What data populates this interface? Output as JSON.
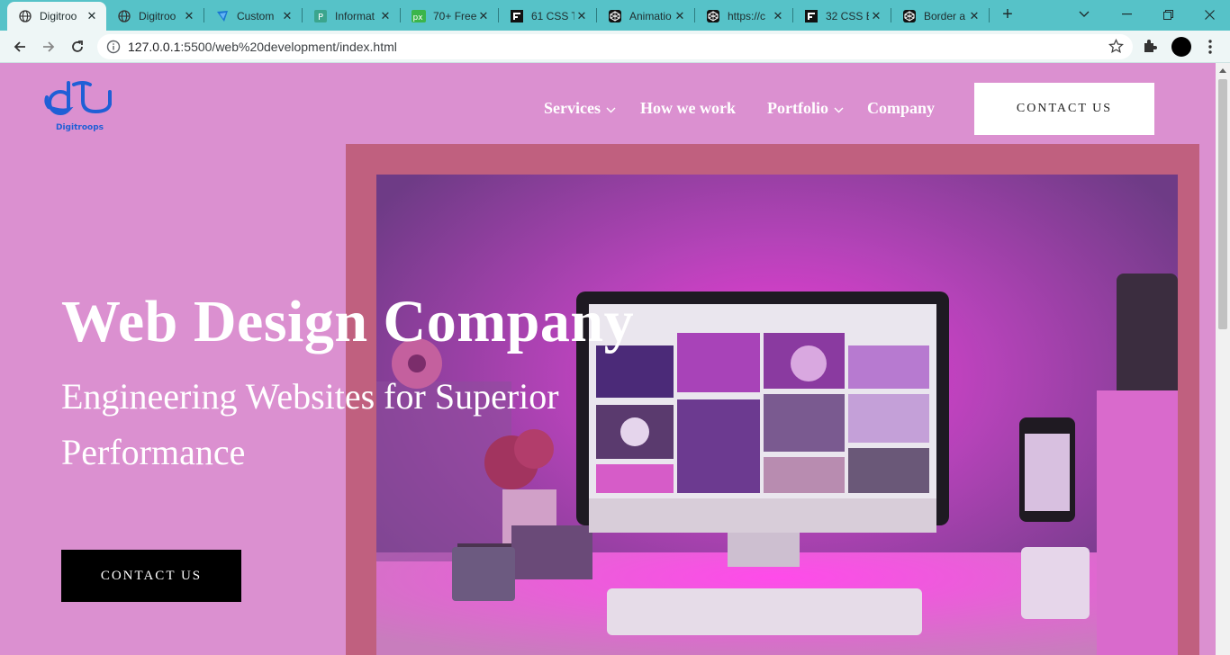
{
  "browser": {
    "tabs": [
      {
        "title": "Digitroo",
        "icon": "globe-icon",
        "active": true
      },
      {
        "title": "Digitroo",
        "icon": "globe-icon",
        "active": false
      },
      {
        "title": "Custom",
        "icon": "angular-icon",
        "active": false
      },
      {
        "title": "Informat",
        "icon": "p-icon",
        "active": false
      },
      {
        "title": "70+ Free",
        "icon": "px-icon",
        "active": false
      },
      {
        "title": "61 CSS T",
        "icon": "f-icon",
        "active": false
      },
      {
        "title": "Animatio",
        "icon": "codepen-icon",
        "active": false
      },
      {
        "title": "https://c",
        "icon": "codepen-icon",
        "active": false
      },
      {
        "title": "32 CSS E",
        "icon": "f-icon",
        "active": false
      },
      {
        "title": "Border a",
        "icon": "codepen-icon",
        "active": false
      }
    ],
    "url_host": "127.0.0.1",
    "url_rest": ":5500/web%20development/index.html"
  },
  "site": {
    "logo_text": "Digitroops",
    "nav": {
      "services": "Services",
      "how": "How we work",
      "portfolio": "Portfolio",
      "company": "Company"
    },
    "contact_top": "CONTACT US",
    "hero": {
      "title": "Web Design Company",
      "subtitle": "Engineering Websites for Superior Performance",
      "cta": "CONTACT US"
    }
  },
  "colors": {
    "page_bg": "#db90d0",
    "frame": "#c0607f",
    "tabbar": "#56c2c8",
    "logo_blue": "#1f5fd6"
  }
}
